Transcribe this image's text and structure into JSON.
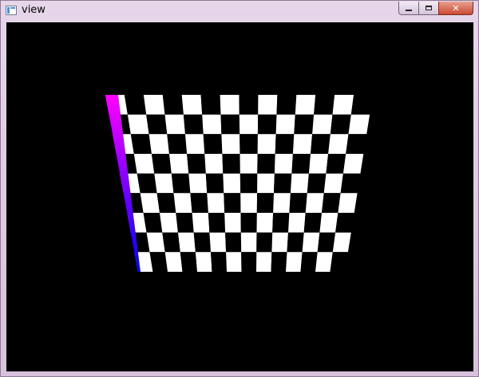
{
  "window": {
    "title": "view",
    "minimize_glyph": "minimize-icon",
    "maximize_glyph": "maximize-icon",
    "close_glyph": "✕"
  },
  "viewport": {
    "background_color": "#000000",
    "board": {
      "columns": 14,
      "rows": 9,
      "light_color": "#ffffff",
      "dark_color": "#000000",
      "edge_gradient": [
        "#ff00ff",
        "#0000ff"
      ]
    }
  }
}
